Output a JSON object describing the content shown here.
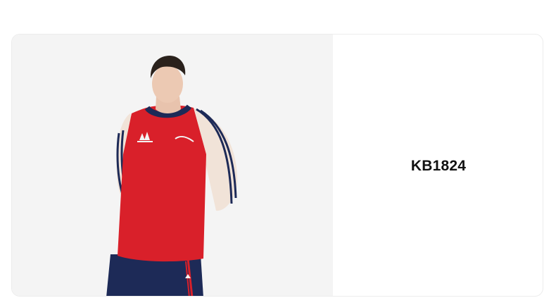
{
  "product": {
    "code": "KB1824",
    "image_icon": "product-photo",
    "colors": {
      "shirt": "#d9202a",
      "sleeve": "#f1e3d8",
      "navy": "#1d2a57",
      "background": "#f4f4f4"
    }
  }
}
